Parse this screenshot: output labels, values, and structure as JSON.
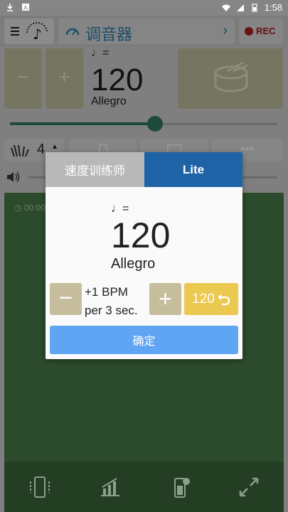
{
  "status_bar": {
    "time": "1:58"
  },
  "topbar": {
    "title": "调音器",
    "rec_label": "REC"
  },
  "tempo": {
    "bpm": "120",
    "note_symbol": "♩=",
    "name": "Allegro"
  },
  "main_buttons": {
    "minus": "−",
    "plus": "+"
  },
  "beats": {
    "count": "4"
  },
  "timer": {
    "text": "00:00"
  },
  "dialog": {
    "tab_trainer": "速度训练师",
    "tab_lite": "Lite",
    "note_symbol": "♩=",
    "bpm": "120",
    "tempo_name": "Allegro",
    "minus": "−",
    "plus": "+",
    "increment": "+1 BPM",
    "interval": "per  3 sec.",
    "reset_value": "120",
    "ok_label": "确定"
  },
  "colors": {
    "dialog_accent": "#1f63a7",
    "confirm": "#5fa5f4",
    "reset": "#ebc850",
    "stepper": "#c6bd9c"
  }
}
